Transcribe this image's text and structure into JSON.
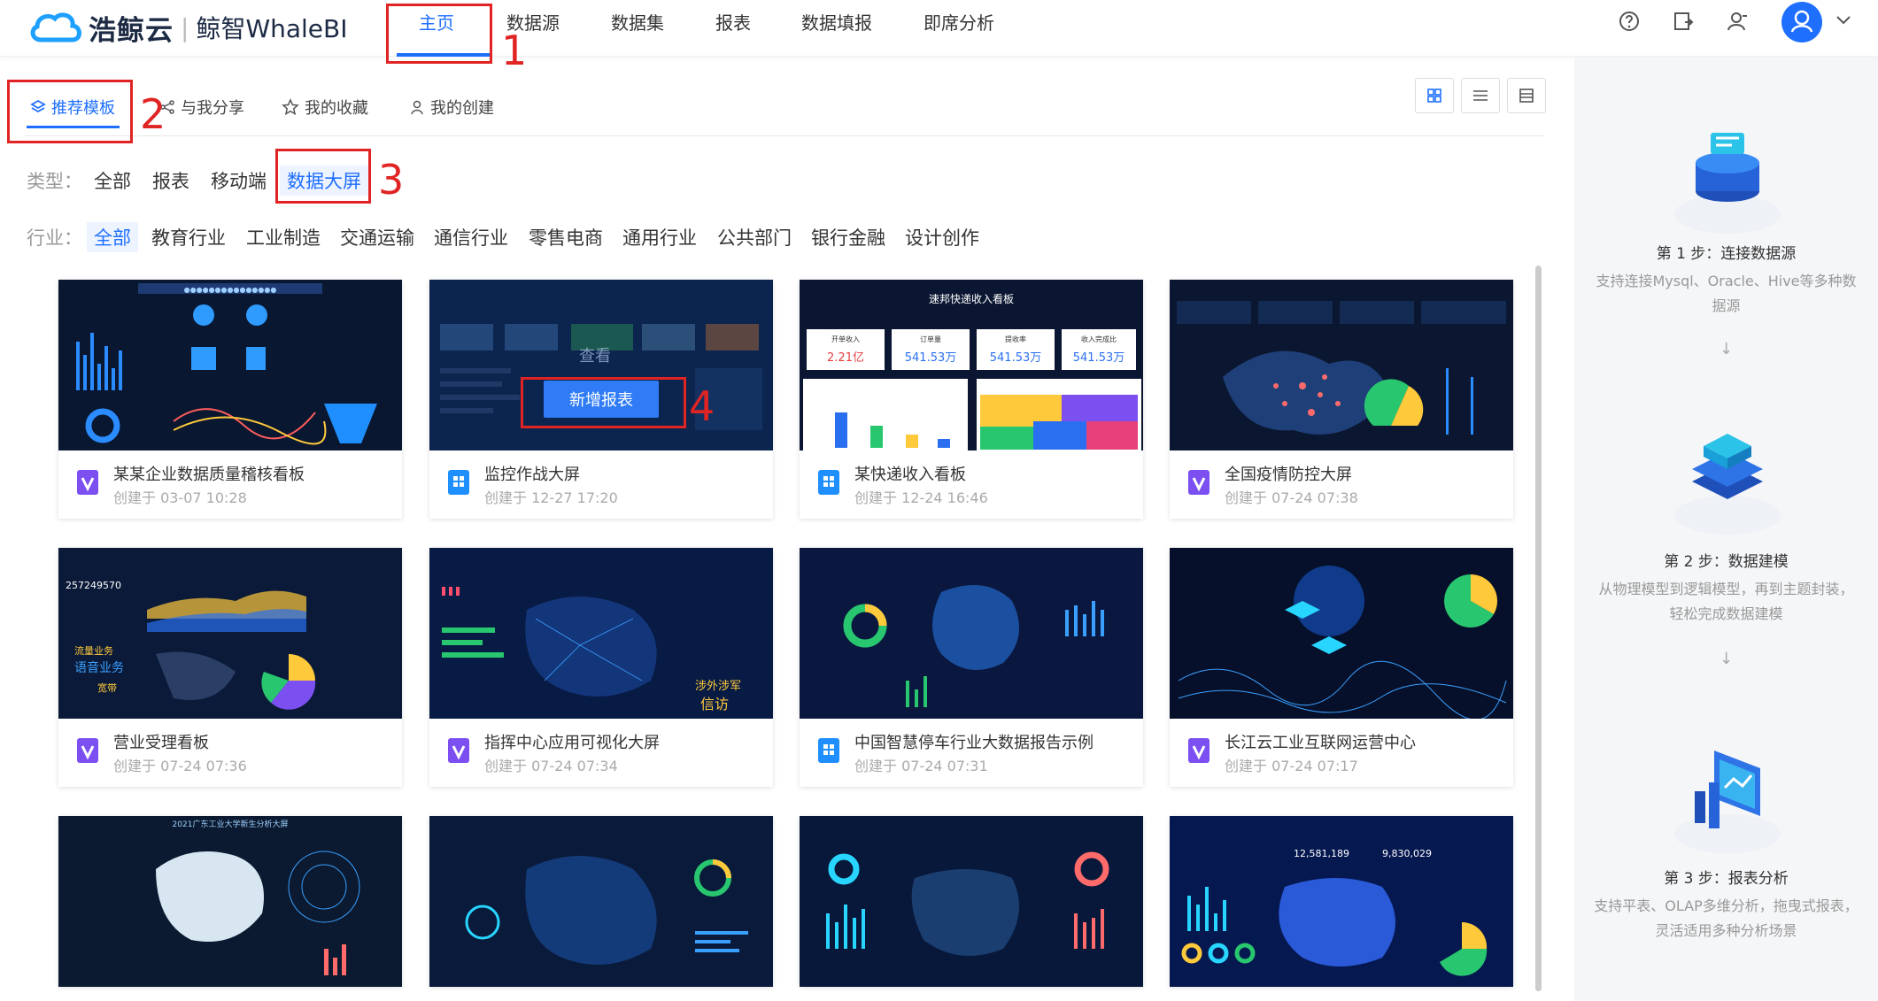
{
  "header": {
    "brand": "浩鲸云",
    "product": "鲸智WhaleBI",
    "nav": [
      "主页",
      "数据源",
      "数据集",
      "报表",
      "数据填报",
      "即席分析"
    ],
    "icons": [
      "help-icon",
      "export-icon",
      "user-icon",
      "avatar-icon",
      "chevron-down-icon"
    ]
  },
  "annotations": [
    "1",
    "2",
    "3",
    "4"
  ],
  "subtabs": [
    "推荐模板",
    "与我分享",
    "我的收藏",
    "我的创建"
  ],
  "filters": {
    "type_label": "类型：",
    "types": [
      "全部",
      "报表",
      "移动端",
      "数据大屏"
    ],
    "industry_label": "行业：",
    "industries": [
      "全部",
      "教育行业",
      "工业制造",
      "交通运输",
      "通信行业",
      "零售电商",
      "通用行业",
      "公共部门",
      "银行金融",
      "设计创作"
    ]
  },
  "hover": {
    "peek_label": "查看",
    "new_report": "新增报表"
  },
  "cards": [
    {
      "title": "某某企业数据质量稽核看板",
      "date": "创建于  03-07 10:28",
      "icon": "dashboard-icon"
    },
    {
      "title": "监控作战大屏",
      "date": "创建于  12-27 17:20",
      "icon": "report-icon"
    },
    {
      "title": "某快递收入看板",
      "date": "创建于  12-24 16:46",
      "icon": "report-icon"
    },
    {
      "title": "全国疫情防控大屏",
      "date": "创建于  07-24 07:38",
      "icon": "dashboard-icon"
    },
    {
      "title": "营业受理看板",
      "date": "创建于  07-24 07:36",
      "icon": "dashboard-icon"
    },
    {
      "title": "指挥中心应用可视化大屏",
      "date": "创建于  07-24 07:34",
      "icon": "dashboard-icon"
    },
    {
      "title": "中国智慧停车行业大数据报告示例",
      "date": "创建于  07-24 07:31",
      "icon": "report-icon"
    },
    {
      "title": "长江云工业互联网运营中心",
      "date": "创建于  07-24 07:17",
      "icon": "dashboard-icon"
    },
    {
      "title": "",
      "date": "",
      "icon": ""
    },
    {
      "title": "",
      "date": "",
      "icon": ""
    },
    {
      "title": "",
      "date": "",
      "icon": ""
    },
    {
      "title": "",
      "date": "",
      "icon": ""
    }
  ],
  "thumb_text": {
    "t3_title": "速邦快递收入看板",
    "t3_kpis": [
      {
        "label": "开单收入",
        "value": "2.21亿"
      },
      {
        "label": "订单量",
        "value": "541.53万"
      },
      {
        "label": "提收率",
        "value": "541.53万"
      },
      {
        "label": "收入完成比",
        "value": "541.53万"
      }
    ],
    "t5_num": "257249570",
    "t5_words": [
      "流量业务",
      "语音业务",
      "宽带"
    ],
    "t9_num": "2021广东工业大学新生分析大屏",
    "t12_nums": [
      "12,581,189",
      "9,830,029"
    ]
  },
  "sidebar": {
    "steps": [
      {
        "title": "第 1 步：连接数据源",
        "desc": "支持连接Mysql、Oracle、Hive等多种数据源"
      },
      {
        "title": "第 2 步：数据建模",
        "desc": "从物理模型到逻辑模型，再到主题封装，轻松完成数据建模"
      },
      {
        "title": "第 3 步：报表分析",
        "desc": "支持平表、OLAP多维分析，拖曳式报表，灵活适用多种分析场景"
      }
    ],
    "arrow": "↓"
  },
  "colors": {
    "accent": "#1f6fff",
    "annotation": "#e02424",
    "dark_bg": "#0b1a33"
  }
}
